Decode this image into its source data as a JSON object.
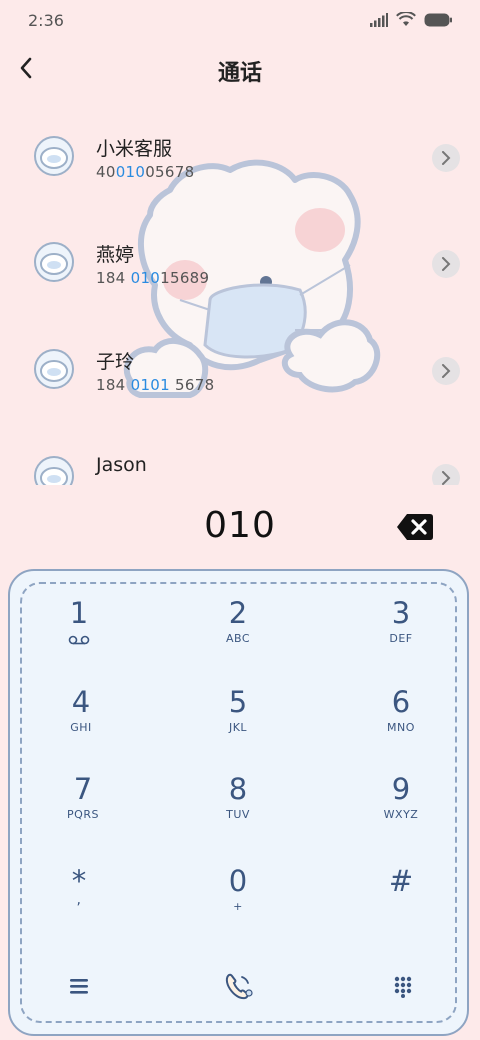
{
  "status_bar": {
    "time": "2:36"
  },
  "header": {
    "title": "通话"
  },
  "contacts": [
    {
      "name": "小米客服",
      "number_pre": "40",
      "number_match": "010",
      "number_post": "05678"
    },
    {
      "name": "燕婷",
      "number_pre": "184 ",
      "number_match": "010",
      "number_post": "15689"
    },
    {
      "name": "子玲",
      "number_pre": "184 ",
      "number_match": "0101",
      "number_post": " 5678"
    },
    {
      "name": "Jason",
      "number_pre": "",
      "number_match": "",
      "number_post": ""
    }
  ],
  "dial_input": {
    "value": "010"
  },
  "keypad": [
    {
      "digit": "1",
      "letters": ""
    },
    {
      "digit": "2",
      "letters": "ABC"
    },
    {
      "digit": "3",
      "letters": "DEF"
    },
    {
      "digit": "4",
      "letters": "GHI"
    },
    {
      "digit": "5",
      "letters": "JKL"
    },
    {
      "digit": "6",
      "letters": "MNO"
    },
    {
      "digit": "7",
      "letters": "PQRS"
    },
    {
      "digit": "8",
      "letters": "TUV"
    },
    {
      "digit": "9",
      "letters": "WXYZ"
    },
    {
      "digit": "*",
      "letters": ","
    },
    {
      "digit": "0",
      "letters": "+"
    },
    {
      "digit": "#",
      "letters": ""
    }
  ],
  "icons": {
    "voicemail": "voicemail-icon",
    "menu": "menu-icon",
    "call": "call-icon",
    "dialpad": "dialpad-icon",
    "delete": "backspace-icon",
    "back": "back-arrow-icon"
  },
  "colors": {
    "accent": "#2a8be0",
    "keypad_text": "#3b5680",
    "background": "#fdeaea"
  }
}
